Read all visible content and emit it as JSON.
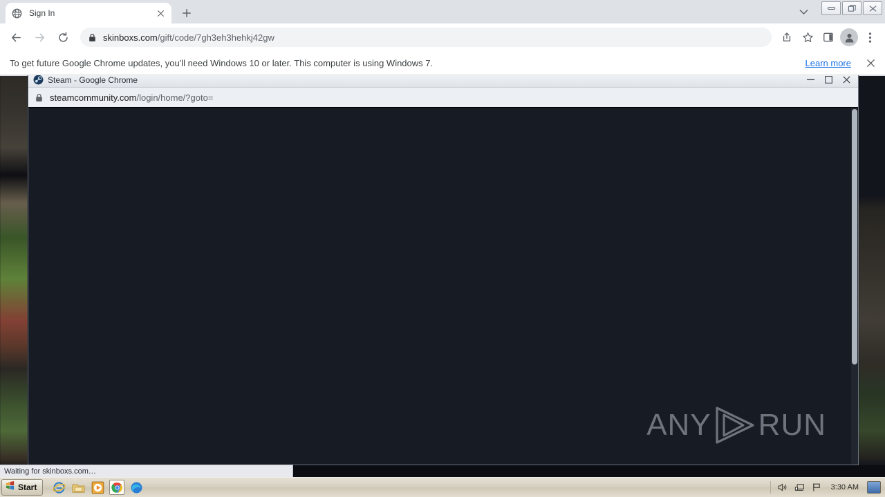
{
  "browser": {
    "tab": {
      "title": "Sign In",
      "favicon": "globe-icon",
      "close": "×"
    },
    "newtab_label": "+",
    "window_controls": {
      "minimize": "—",
      "restore": "❐",
      "close": "✕",
      "collapse": "˅"
    },
    "nav": {
      "back": "←",
      "forward": "→",
      "reload": "↻"
    },
    "omnibox": {
      "lock": "lock-icon",
      "host": "skinboxs.com",
      "path": "/gift/code/7gh3eh3hehkj42gw",
      "full_url": "skinboxs.com/gift/code/7gh3eh3hehkj42gw"
    },
    "toolbar_icons": {
      "share": "share-icon",
      "bookmark": "star-icon",
      "side_panel": "side-panel-icon",
      "profile": "profile-avatar-icon",
      "menu": "three-dot-menu-icon"
    }
  },
  "infobar": {
    "message": "To get future Google Chrome updates, you'll need Windows 10 or later. This computer is using Windows 7.",
    "learn_more": "Learn more",
    "close": "✕"
  },
  "popup": {
    "title": "Steam - Google Chrome",
    "favicon": "steam-icon",
    "controls": {
      "minimize": "—",
      "maximize": "❐",
      "close": "✕"
    },
    "omnibox": {
      "lock": "lock-icon",
      "host": "steamcommunity.com",
      "path": "/login/home/?goto=",
      "full_url": "steamcommunity.com/login/home/?goto="
    },
    "body_color": "#171b24"
  },
  "watermark": {
    "left_text": "ANY",
    "right_text": "RUN",
    "logo": "play-triangle-icon"
  },
  "status": {
    "text": "Waiting for skinboxs.com…"
  },
  "taskbar": {
    "start_label": "Start",
    "quick_launch": [
      {
        "name": "internet-explorer-icon"
      },
      {
        "name": "file-explorer-icon"
      },
      {
        "name": "media-player-icon"
      },
      {
        "name": "google-chrome-icon",
        "active": true
      },
      {
        "name": "microsoft-edge-icon"
      }
    ],
    "tray": {
      "volume": "volume-icon",
      "network": "network-icon",
      "action_center": "flag-icon",
      "clock": "3:30 AM",
      "show_desktop": "show-desktop-icon"
    }
  },
  "colors": {
    "chrome_frame": "#dee1e6",
    "page_dark": "#171b24",
    "link_blue": "#1a73e8",
    "taskbar": "#d6d0c0"
  }
}
